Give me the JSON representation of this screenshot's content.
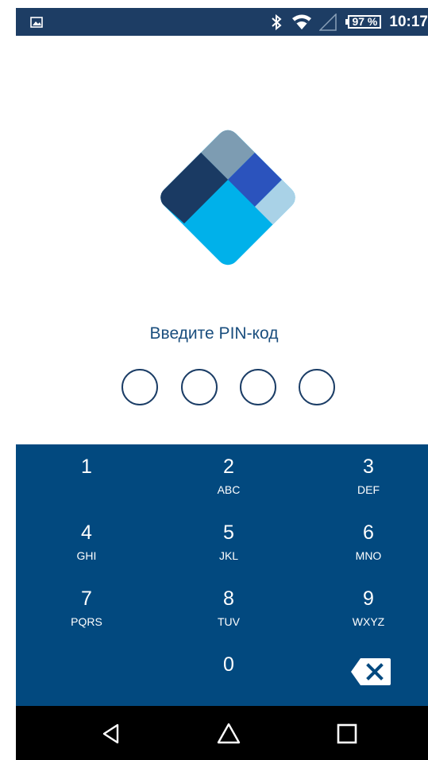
{
  "status_bar": {
    "battery": "97 %",
    "time": "10:17",
    "icons": [
      "image-notification-icon",
      "bluetooth-icon",
      "wifi-icon",
      "signal-icon",
      "battery-icon"
    ]
  },
  "logo": {
    "name": "diamond-logo",
    "colors": [
      "#1a3a63",
      "#7d9cb2",
      "#2b53bd",
      "#00b1ea",
      "#a9d2e7"
    ]
  },
  "prompt": "Введите PIN-код",
  "pin": {
    "length": 4,
    "entered": 0
  },
  "keypad": {
    "keys": [
      {
        "digit": "1",
        "letters": ""
      },
      {
        "digit": "2",
        "letters": "ABC"
      },
      {
        "digit": "3",
        "letters": "DEF"
      },
      {
        "digit": "4",
        "letters": "GHI"
      },
      {
        "digit": "5",
        "letters": "JKL"
      },
      {
        "digit": "6",
        "letters": "MNO"
      },
      {
        "digit": "7",
        "letters": "PQRS"
      },
      {
        "digit": "8",
        "letters": "TUV"
      },
      {
        "digit": "9",
        "letters": "WXYZ"
      },
      {
        "digit": "0",
        "letters": ""
      }
    ],
    "backspace_icon": "backspace-icon"
  },
  "nav_bar": {
    "icons": [
      "back-icon",
      "home-icon",
      "recents-icon"
    ]
  },
  "colors": {
    "status_bar": "#1d3d64",
    "keypad": "#02497f",
    "prompt": "#1a4e7e",
    "nav_bar": "#000000"
  }
}
